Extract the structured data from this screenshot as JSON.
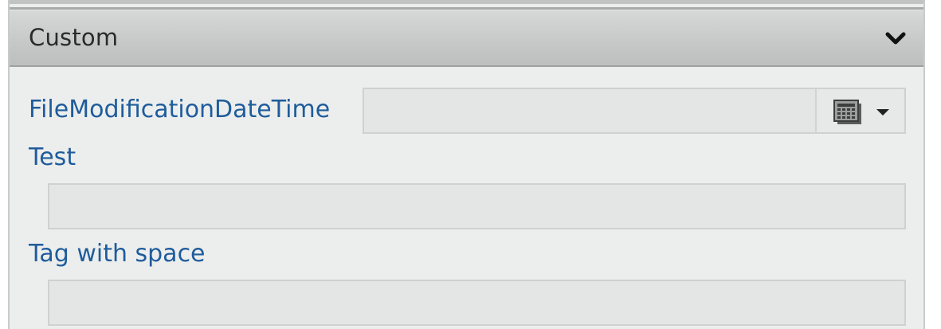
{
  "section": {
    "title": "Custom",
    "expanded": true,
    "toggle_icon": "chevron-down-icon"
  },
  "fields": [
    {
      "label": "FileModificationDateTime",
      "type": "datetime",
      "value": "",
      "button_icons": [
        "calendar-icon",
        "dropdown-arrow-icon"
      ]
    },
    {
      "label": "Test",
      "type": "text",
      "value": ""
    },
    {
      "label": "Tag with space",
      "type": "text",
      "value": ""
    }
  ],
  "colors": {
    "label": "#1f5c9c",
    "panel_background": "#eceeed",
    "header_background": "#c6c8c7",
    "field_background": "#e4e6e5"
  }
}
